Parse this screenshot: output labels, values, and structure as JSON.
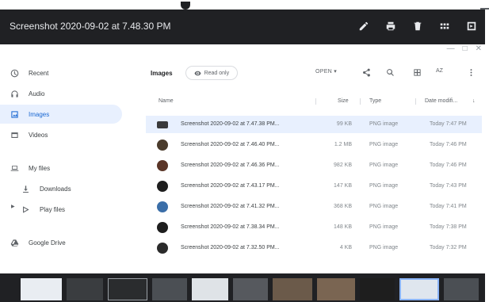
{
  "viewer": {
    "title": "Screenshot 2020-09-02 at 7.48.30 PM",
    "icons": [
      "pencil-icon",
      "print-icon",
      "delete-icon",
      "grid-icon",
      "slideshow-icon"
    ]
  },
  "sidebar": {
    "items": [
      {
        "label": "Recent",
        "icon": "clock-icon"
      },
      {
        "label": "Audio",
        "icon": "headphones-icon"
      },
      {
        "label": "Images",
        "icon": "image-icon"
      },
      {
        "label": "Videos",
        "icon": "film-icon"
      },
      {
        "label": "My files",
        "icon": "laptop-icon"
      },
      {
        "label": "Downloads",
        "icon": "download-icon"
      },
      {
        "label": "Play files",
        "icon": "play-icon"
      },
      {
        "label": "Google Drive",
        "icon": "drive-icon"
      }
    ]
  },
  "toolbar": {
    "breadcrumb": "Images",
    "read_only": "Read only",
    "open": "OPEN",
    "sort": "AZ"
  },
  "columns": {
    "name": "Name",
    "size": "Size",
    "type": "Type",
    "date": "Date modifi..."
  },
  "files": [
    {
      "name": "Screenshot 2020-09-02 at 7.47.38 PM...",
      "size": "99 KB",
      "type": "PNG image",
      "date": "Today 7:47 PM"
    },
    {
      "name": "Screenshot 2020-09-02 at 7.46.40 PM...",
      "size": "1.2 MB",
      "type": "PNG image",
      "date": "Today 7:46 PM"
    },
    {
      "name": "Screenshot 2020-09-02 at 7.46.36 PM...",
      "size": "982 KB",
      "type": "PNG image",
      "date": "Today 7:46 PM"
    },
    {
      "name": "Screenshot 2020-09-02 at 7.43.17 PM...",
      "size": "147 KB",
      "type": "PNG image",
      "date": "Today 7:43 PM"
    },
    {
      "name": "Screenshot 2020-09-02 at 7.41.32 PM...",
      "size": "368 KB",
      "type": "PNG image",
      "date": "Today 7:41 PM"
    },
    {
      "name": "Screenshot 2020-09-02 at 7.38.34 PM...",
      "size": "148 KB",
      "type": "PNG image",
      "date": "Today 7:38 PM"
    },
    {
      "name": "Screenshot 2020-09-02 at 7.32.50 PM...",
      "size": "4 KB",
      "type": "PNG image",
      "date": "Today 7:32 PM"
    }
  ],
  "colors": {
    "viewer_bar": "#202124",
    "selection": "#e8f0fe",
    "accent": "#1967d2"
  }
}
